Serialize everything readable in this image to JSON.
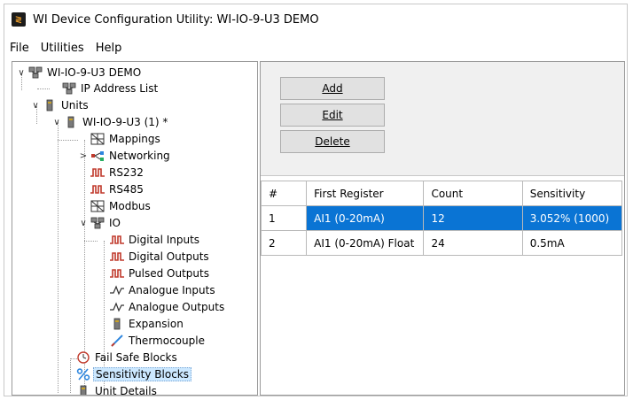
{
  "app": {
    "title": "WI Device Configuration Utility: WI-IO-9-U3 DEMO",
    "icon": "app-logo-icon"
  },
  "menu": [
    "File",
    "Utilities",
    "Help"
  ],
  "tree": [
    {
      "label": "WI-IO-9-U3 DEMO",
      "icon": "network-icon",
      "expander": "expanded"
    },
    {
      "label": "IP Address List",
      "icon": "network-icon"
    },
    {
      "label": "Units",
      "icon": "unit-icon",
      "expander": "expanded"
    },
    {
      "label": "WI-IO-9-U3 (1) *",
      "icon": "unit-icon",
      "expander": "expanded"
    },
    {
      "label": "Mappings",
      "icon": "mapping-icon"
    },
    {
      "label": "Networking",
      "icon": "networking-icon",
      "expander": "collapsed"
    },
    {
      "label": "RS232",
      "icon": "digital-signal-icon"
    },
    {
      "label": "RS485",
      "icon": "digital-signal-icon"
    },
    {
      "label": "Modbus",
      "icon": "mapping-icon"
    },
    {
      "label": "IO",
      "icon": "network-icon",
      "expander": "expanded"
    },
    {
      "label": "Digital Inputs",
      "icon": "digital-signal-icon"
    },
    {
      "label": "Digital Outputs",
      "icon": "digital-signal-icon"
    },
    {
      "label": "Pulsed Outputs",
      "icon": "digital-signal-icon"
    },
    {
      "label": "Analogue Inputs",
      "icon": "analogue-signal-icon"
    },
    {
      "label": "Analogue Outputs",
      "icon": "analogue-signal-icon"
    },
    {
      "label": "Expansion",
      "icon": "unit-icon"
    },
    {
      "label": "Thermocouple",
      "icon": "thermocouple-icon"
    },
    {
      "label": "Fail Safe Blocks",
      "icon": "fail-safe-icon"
    },
    {
      "label": "Sensitivity Blocks",
      "icon": "percent-icon",
      "selected": true
    },
    {
      "label": "Unit Details",
      "icon": "unit-icon"
    }
  ],
  "buttons": {
    "add": "Add",
    "edit": "Edit",
    "delete": "Delete"
  },
  "grid": {
    "columns": [
      "#",
      "First Register",
      "Count",
      "Sensitivity"
    ],
    "rows": [
      [
        "1",
        "AI1 (0-20mA)",
        "12",
        "3.052% (1000)"
      ],
      [
        "2",
        "AI1 (0-20mA) Float",
        "24",
        "0.5mA"
      ]
    ],
    "selected_row": 0
  },
  "colors": {
    "selection": "#0a74d4",
    "tree_selection": "#cce8ff"
  }
}
